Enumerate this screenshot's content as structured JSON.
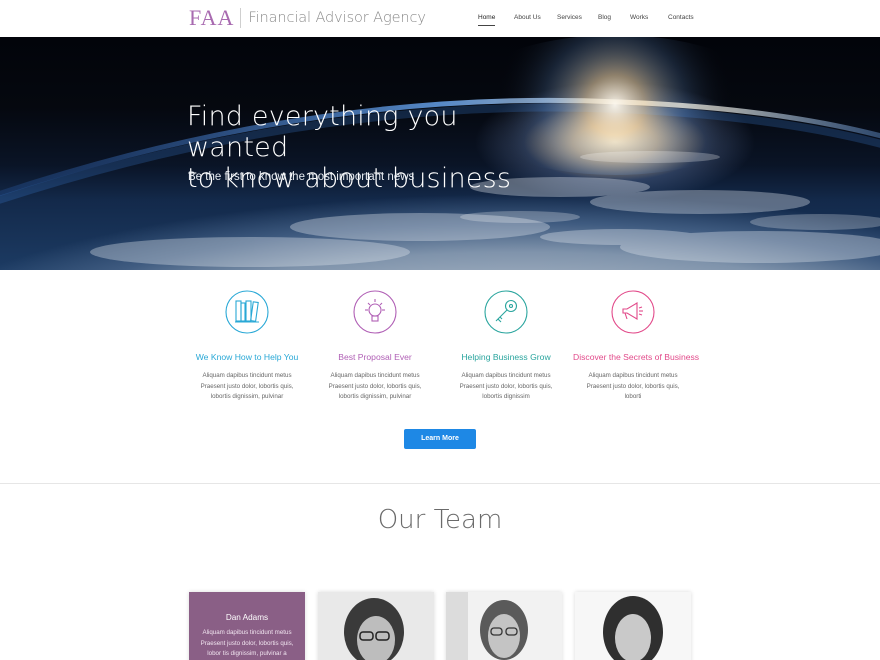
{
  "header": {
    "logo_mark": "FAA",
    "logo_text": "Financial Advisor Agency",
    "nav": [
      "Home",
      "About Us",
      "Services",
      "Blog",
      "Works",
      "Contacts"
    ],
    "active_nav": "Home"
  },
  "hero": {
    "title_line1": "Find everything you wanted",
    "title_line2": "to know about business",
    "subtitle": "Be the first to know the most important news"
  },
  "features": [
    {
      "icon": "books-icon",
      "title": "We Know How to Help You",
      "color": "#29a8d6",
      "text": "Aliquam dapibus tincidunt metus Praesent justo dolor, lobortis quis, lobortis dignissim, pulvinar"
    },
    {
      "icon": "lightbulb-icon",
      "title": "Best Proposal Ever",
      "color": "#b05fb5",
      "text": "Aliquam dapibus tincidunt metus Praesent justo dolor, lobortis quis, lobortis dignissim, pulvinar"
    },
    {
      "icon": "key-icon",
      "title": "Helping Business Grow",
      "color": "#2aa59e",
      "text": "Aliquam dapibus tincidunt metus Praesent justo dolor, lobortis quis, lobortis dignissim"
    },
    {
      "icon": "megaphone-icon",
      "title": "Discover the Secrets of Business",
      "color": "#e24a8a",
      "text": "Aliquam dapibus tincidunt metus Praesent justo dolor, lobortis quis, loborti"
    }
  ],
  "cta": {
    "label": "Learn More",
    "color": "#1e88e5"
  },
  "team": {
    "title": "Our Team",
    "first_card": {
      "name": "Dan Adams",
      "text": "Aliquam dapibus tincidunt metus Praesent justo dolor, lobortis quis, lobor tis dignissim, pulvinar a"
    },
    "accent": "#8a5f86"
  }
}
